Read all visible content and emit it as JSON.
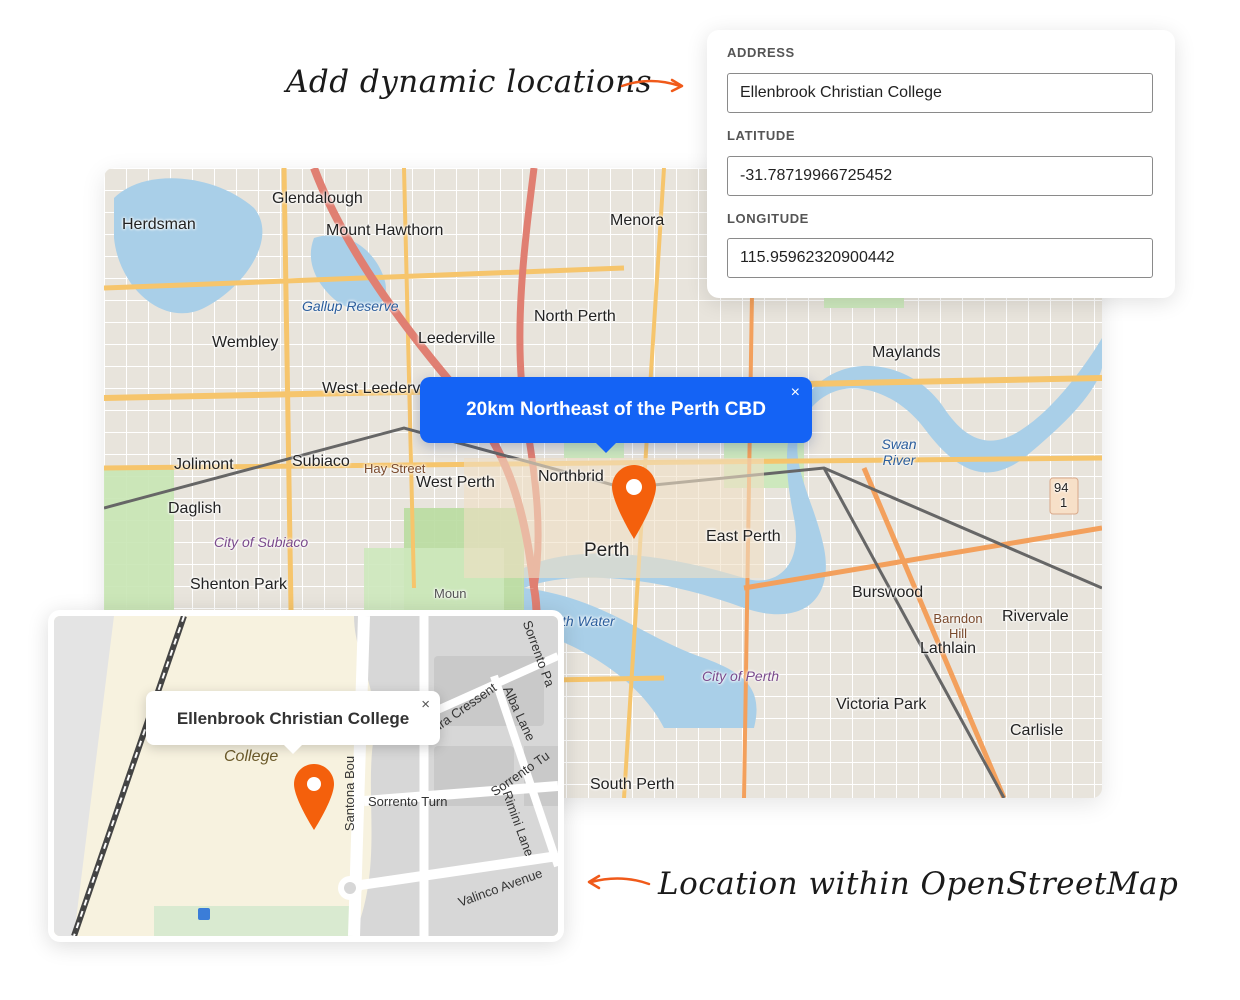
{
  "annotations": {
    "top": "Add dynamic locations",
    "bottom": "Location within OpenStreetMap"
  },
  "form": {
    "address_label": "ADDRESS",
    "address_value": "Ellenbrook Christian College",
    "latitude_label": "LATITUDE",
    "latitude_value": "-31.78719966725452",
    "longitude_label": "LONGITUDE",
    "longitude_value": "115.95962320900442"
  },
  "main_map": {
    "popup_text": "20km Northeast of the Perth CBD",
    "close_symbol": "×",
    "marker_color": "#f4600c",
    "popup_color": "#1463f5",
    "labels": {
      "herdsman": "Herdsman",
      "glendalough": "Glendalough",
      "mount_hawthorn": "Mount Hawthorn",
      "menora": "Menora",
      "gallup_reserve": "Gallup Reserve",
      "north_perth": "North Perth",
      "wembley": "Wembley",
      "leederville": "Leederville",
      "west_leederville": "West Leederv",
      "maylands": "Maylands",
      "jolimont": "Jolimont",
      "subiaco": "Subiaco",
      "hay_street": "Hay Street",
      "west_perth": "West Perth",
      "northbridge": "Northbrid",
      "daglish": "Daglish",
      "city_of_subiaco": "City of Subiaco",
      "perth": "Perth",
      "east_perth": "East Perth",
      "shenton_park": "Shenton Park",
      "mount": "Moun",
      "burswood": "Burswood",
      "perth_water": "th Water",
      "barndon_hill": "Barndon Hill",
      "rivervale": "Rivervale",
      "lathlain": "Lathlain",
      "city_of_perth": "City of Perth",
      "victoria_park": "Victoria Park",
      "carlisle": "Carlisle",
      "south_perth": "South Perth",
      "swan_river": "Swan River",
      "route_94": "94",
      "route_1": "1"
    }
  },
  "inset_map": {
    "popup_text": "Ellenbrook Christian College",
    "close_symbol": "×",
    "marker_color": "#f4600c",
    "labels": {
      "college": "College",
      "sorrento_turn": "Sorrento Turn",
      "sorrento_tu": "Sorrento Tu",
      "sorrento_pa": "Sorrento Pa",
      "laura_cressent": "Laura Cressent",
      "alba_lane": "Alba Lane",
      "rimini_lane": "Rimini Lane",
      "santona_boulevard": "Santona Bou",
      "valinco_avenue": "Valinco Avenue"
    }
  }
}
